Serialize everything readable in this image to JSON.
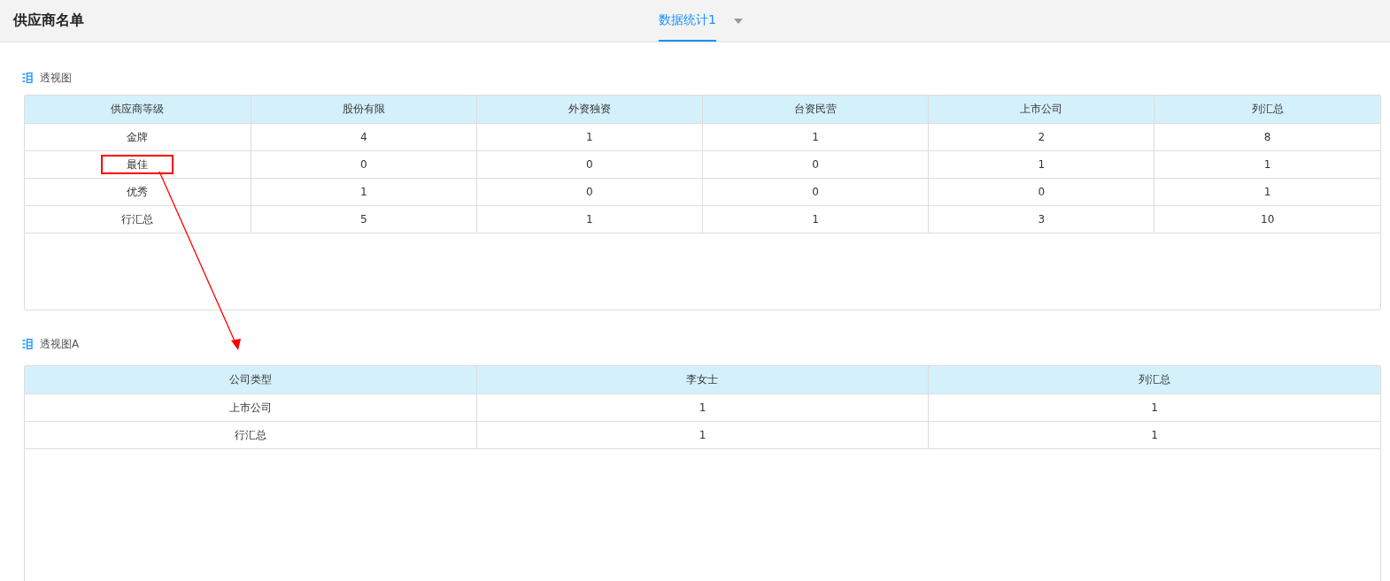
{
  "header": {
    "title": "供应商名单",
    "tabs": [
      {
        "label": "数据统计1",
        "selected": true
      }
    ]
  },
  "pivots": [
    {
      "title": "透视图",
      "columns": [
        "供应商等级",
        "股份有限",
        "外资独资",
        "台资民营",
        "上市公司",
        "列汇总"
      ],
      "rows": [
        {
          "label": "金牌",
          "highlighted": false,
          "values": [
            "4",
            "1",
            "1",
            "2",
            "8"
          ]
        },
        {
          "label": "最佳",
          "highlighted": true,
          "values": [
            "0",
            "0",
            "0",
            "1",
            "1"
          ]
        },
        {
          "label": "优秀",
          "highlighted": false,
          "values": [
            "1",
            "0",
            "0",
            "0",
            "1"
          ]
        },
        {
          "label": "行汇总",
          "highlighted": false,
          "values": [
            "5",
            "1",
            "1",
            "3",
            "10"
          ]
        }
      ]
    },
    {
      "title": "透视图A",
      "columns": [
        "公司类型",
        "李女士",
        "列汇总"
      ],
      "rows": [
        {
          "label": "上市公司",
          "highlighted": false,
          "values": [
            "1",
            "1"
          ]
        },
        {
          "label": "行汇总",
          "highlighted": false,
          "values": [
            "1",
            "1"
          ]
        }
      ]
    }
  ]
}
